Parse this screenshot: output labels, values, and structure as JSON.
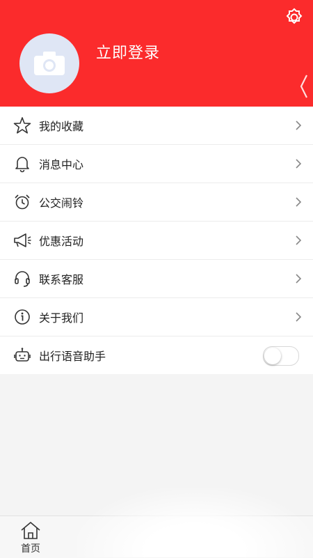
{
  "header": {
    "login_label": "立即登录",
    "settings_icon": "gear-icon",
    "avatar_icon": "camera-icon",
    "side_icon": "chevron-left-icon",
    "color": "#fb2b2c"
  },
  "menu": {
    "items": [
      {
        "label": "我的收藏",
        "icon": "star-icon"
      },
      {
        "label": "消息中心",
        "icon": "bell-icon"
      },
      {
        "label": "公交闹铃",
        "icon": "alarm-clock-icon"
      },
      {
        "label": "优惠活动",
        "icon": "megaphone-icon"
      },
      {
        "label": "联系客服",
        "icon": "headset-icon"
      },
      {
        "label": "关于我们",
        "icon": "info-icon"
      },
      {
        "label": "出行语音助手",
        "icon": "robot-icon",
        "toggle": false
      }
    ]
  },
  "tabbar": {
    "tabs": [
      {
        "label": "首页",
        "icon": "home-icon"
      }
    ]
  }
}
